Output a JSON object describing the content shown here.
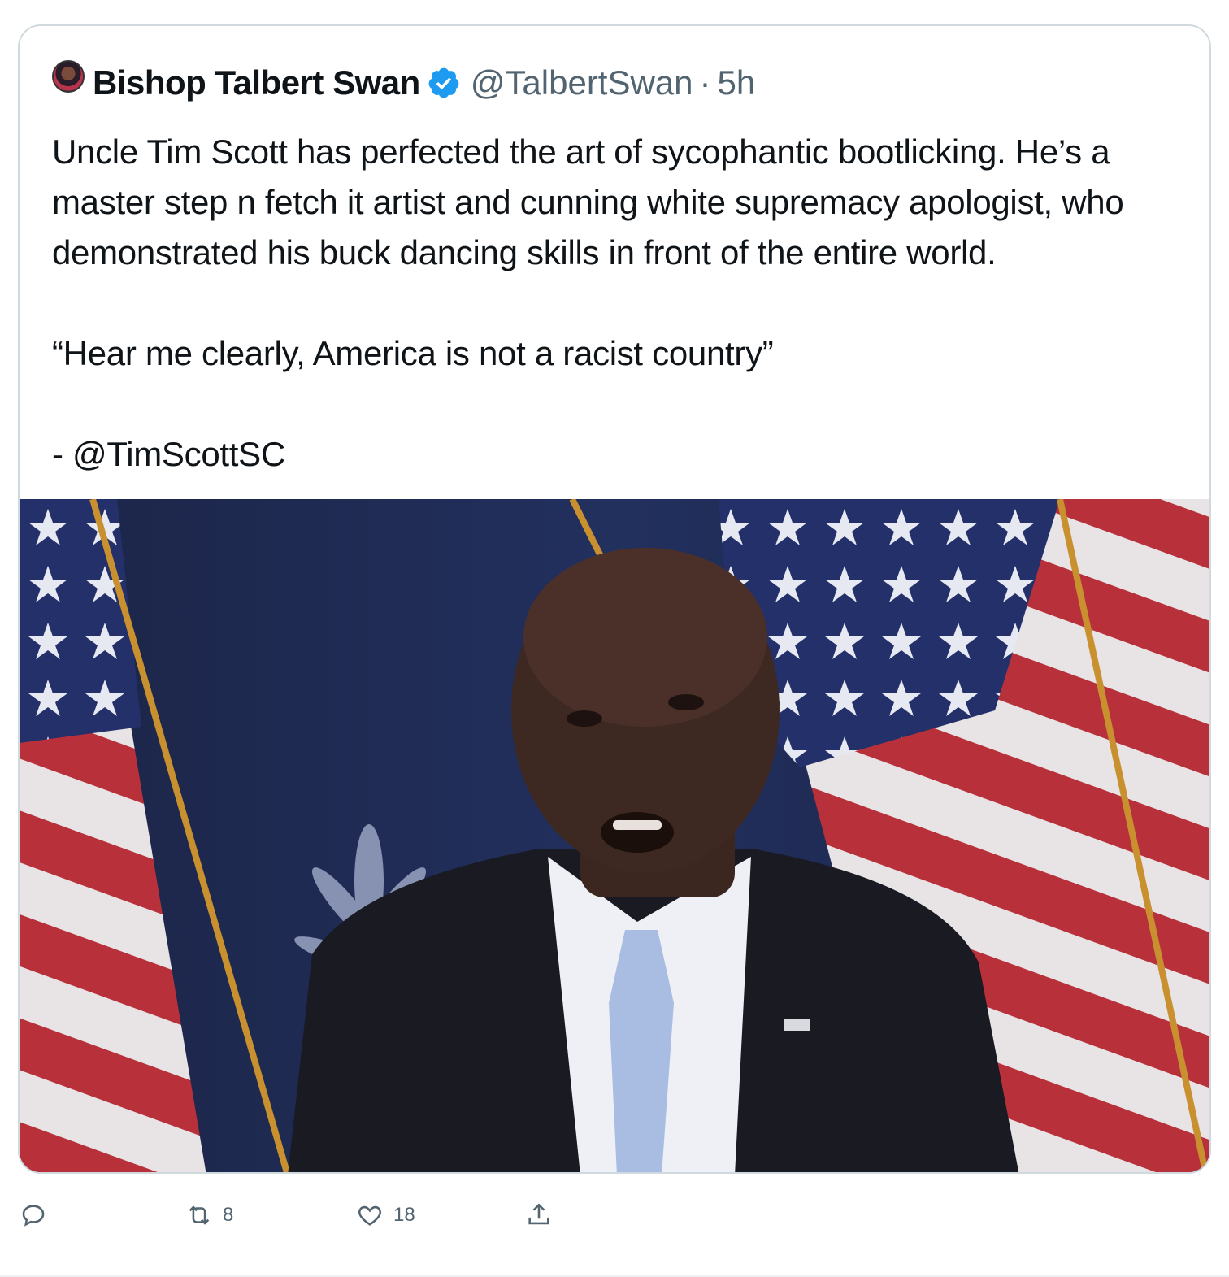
{
  "tweet": {
    "author_name": "Bishop Talbert Swan",
    "handle": "@TalbertSwan",
    "separator": "·",
    "time": "5h",
    "verified_icon": "verified-badge-icon",
    "avatar": "author-avatar",
    "text": {
      "paragraph_1": "Uncle Tim Scott has perfected the art of sycophantic bootlicking. He’s a master step n fetch it artist and cunning white supremacy apologist, who demonstrated his buck dancing skills in front of the entire world.",
      "paragraph_2": "“Hear me clearly, America is not a racist country”",
      "paragraph_3": "- @TimScottSC"
    },
    "media": {
      "type": "video-still",
      "description_icon": "tweet-media-image"
    }
  },
  "actions": {
    "reply": {
      "icon": "reply-icon",
      "count": ""
    },
    "retweet": {
      "icon": "retweet-icon",
      "count": "8"
    },
    "like": {
      "icon": "heart-icon",
      "count": "18"
    },
    "share": {
      "icon": "share-icon",
      "count": ""
    }
  },
  "colors": {
    "text": "#0f1419",
    "secondary": "#536471",
    "verified": "#1d9bf0",
    "border": "#cfd9de"
  }
}
